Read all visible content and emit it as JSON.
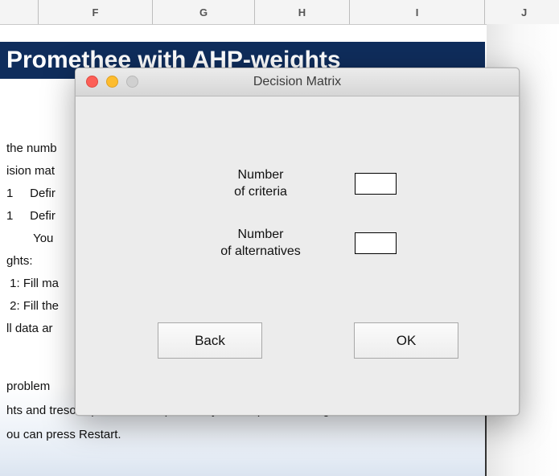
{
  "spreadsheet": {
    "columns": [
      "F",
      "G",
      "H",
      "I",
      "J"
    ],
    "banner_title": "Promethee with AHP-weights",
    "lines": [
      "the numb",
      "ision mat",
      "1     Defir",
      "1     Defir",
      "        You",
      "ghts:",
      " 1: Fill ma",
      " 2: Fill the",
      "ll data ar",
      "",
      " problem",
      "hts and tresolds) in the same problem you can press Run Again.",
      "ou can press Restart."
    ]
  },
  "dialog": {
    "title": "Decision Matrix",
    "criteria": {
      "label_line1": "Number",
      "label_line2": "of criteria",
      "value": ""
    },
    "alternatives": {
      "label_line1": "Number",
      "label_line2": "of alternatives",
      "value": ""
    },
    "back_label": "Back",
    "ok_label": "OK"
  }
}
